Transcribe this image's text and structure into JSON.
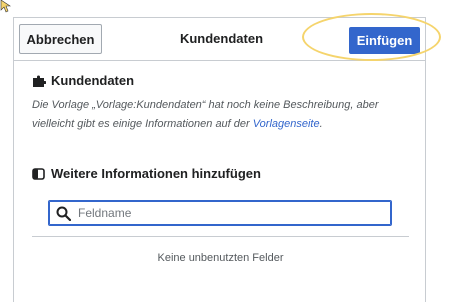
{
  "dialog": {
    "title": "Kundendaten",
    "cancel_label": "Abbrechen",
    "insert_label": "Einfügen"
  },
  "template_section": {
    "heading": "Kundendaten",
    "icon": "puzzle-icon",
    "description_prefix": "Die Vorlage „Vorlage:Kundendaten“ hat noch keine Beschreibung, aber vielleicht gibt es einige Informationen auf der ",
    "description_link": "Vorlagenseite",
    "description_suffix": "."
  },
  "add_info_section": {
    "heading": "Weitere Informationen hinzufügen",
    "icon": "toggle-icon",
    "search": {
      "placeholder": "Feldname",
      "value": "",
      "icon": "search-icon"
    },
    "empty_message": "Keine unbenutzten Felder"
  },
  "colors": {
    "accent": "#3366cc",
    "highlight": "#f5d46c",
    "border": "#c8ccd1"
  }
}
